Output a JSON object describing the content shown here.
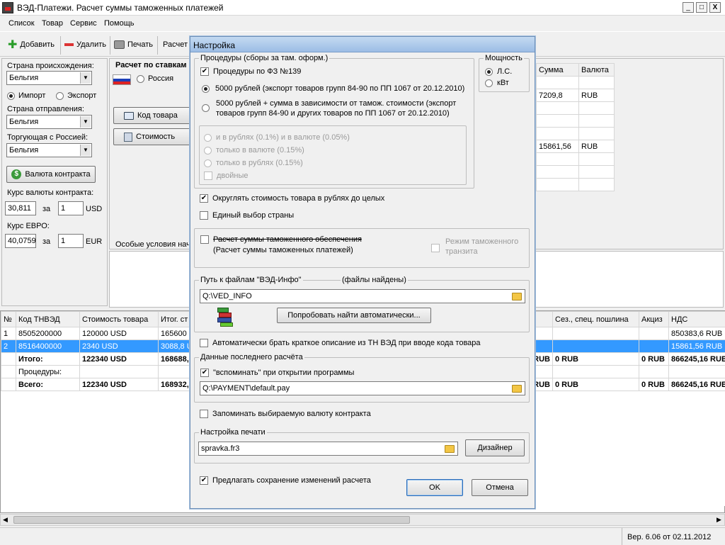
{
  "window": {
    "title": "ВЭД-Платежи. Расчет суммы таможенных платежей",
    "min": "_",
    "max": "□",
    "close": "X"
  },
  "menu": [
    "Список",
    "Товар",
    "Сервис",
    "Помощь"
  ],
  "toolbar": {
    "add": "Добавить",
    "delete": "Удалить",
    "print": "Печать",
    "calc": "Расчет"
  },
  "left": {
    "origin_label": "Страна происхождения:",
    "origin_value": "Бельгия",
    "import": "Импорт",
    "export": "Экспорт",
    "dispatch_label": "Страна отправления:",
    "dispatch_value": "Бельгия",
    "trading_label": "Торгующая с Россией:",
    "trading_value": "Бельгия",
    "currency_btn": "Валюта контракта",
    "rate_label": "Курс валюты контракта:",
    "rate_value": "30,811",
    "per": "за",
    "rate_qty": "1",
    "rate_cur": "USD",
    "euro_label": "Курс ЕВРО:",
    "euro_value": "40,0759",
    "euro_qty": "1",
    "euro_cur": "EUR"
  },
  "middle": {
    "rates_title": "Расчет по ставкам",
    "russia": "Россия",
    "code_btn": "Код товара",
    "cost_btn": "Стоимость",
    "special": "Особые условия нач"
  },
  "right_grid": {
    "headers": [
      "Сумма",
      "Валюта"
    ],
    "rows": [
      [
        "",
        ""
      ],
      [
        "7209,8",
        "RUB"
      ],
      [
        "",
        ""
      ],
      [
        "",
        ""
      ],
      [
        "",
        ""
      ],
      [
        "15861,56",
        "RUB"
      ],
      [
        "",
        ""
      ],
      [
        "",
        ""
      ],
      [
        "",
        ""
      ]
    ]
  },
  "bottom_grid": {
    "headers": [
      "№",
      "Код ТНВЭД",
      "Стоимость товара",
      "Итог. ст",
      "",
      "Сез., спец. пошлина",
      "Акциз",
      "НДС"
    ],
    "rows": [
      [
        "1",
        "8505200000",
        "120000 USD",
        "165600 U",
        "",
        "",
        "",
        "850383,6 RUB"
      ],
      [
        "2",
        "8516400000",
        "2340 USD",
        "3088,8 U",
        "",
        "",
        "",
        "15861,56 RUB"
      ],
      [
        "",
        "Итого:",
        "122340 USD",
        "168688,8",
        "RUB",
        "0 RUB",
        "0 RUB",
        "866245,16 RUB"
      ],
      [
        "",
        "Процедуры:",
        "",
        "",
        "",
        "",
        "",
        ""
      ],
      [
        "",
        "Всего:",
        "122340 USD",
        "168932,2",
        "RUB",
        "0 RUB",
        "0 RUB",
        "866245,16 RUB"
      ]
    ]
  },
  "status": {
    "version": "Вер. 6.06 от 02.11.2012"
  },
  "dialog": {
    "title": "Настройка",
    "proc_group": "Процедуры (сборы за там. оформ.)",
    "fz139": "Процедуры по ФЗ №139",
    "opt1": "5000 рублей (экспорт товаров групп 84-90 по ПП 1067 от 20.12.2010)",
    "opt2_l1": "5000 рублей + сумма в зависимости от тамож. стоимости (экспорт",
    "opt2_l2": "товаров групп 84-90 и других товаров по ПП 1067 от 20.12.2010)",
    "sub1": "и в рублях (0.1%) и в валюте (0.05%)",
    "sub2": "только в валюте (0.15%)",
    "sub3": "только в рублях (0.15%)",
    "sub4": "двойные",
    "power_group": "Мощность",
    "ls": "Л.С.",
    "kvt": "кВт",
    "round": "Округлять стоимость товара в рублях до целых",
    "single_country": "Единый выбор страны",
    "guarantee": "Расчет суммы таможенного обеспечения",
    "guarantee_sub": "(Расчет суммы таможенных платежей)",
    "transit_l1": "Режим таможенного",
    "transit_l2": "транзита",
    "path_group": "Путь к файлам \"ВЭД-Инфо\"",
    "path_found": "(файлы найдены)",
    "path_value": "Q:\\VED_INFO",
    "auto_find": "Попробовать найти автоматически...",
    "auto_desc": "Автоматически брать краткое описание из ТН ВЭД при вводе кода товара",
    "last_group": "Данные последнего расчёта",
    "remember": "\"вспоминать\" при открытии программы",
    "last_path": "Q:\\PAYMENT\\default.pay",
    "remember_cur": "Запоминать выбираемую валюту контракта",
    "print_group": "Настройка печати",
    "print_file": "spravka.fr3",
    "designer": "Дизайнер",
    "offer_save": "Предлагать сохранение изменений расчета",
    "ok": "OK",
    "cancel": "Отмена"
  }
}
